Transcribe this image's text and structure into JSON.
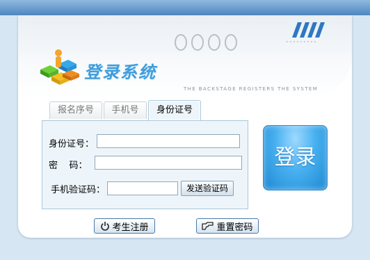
{
  "app": {
    "title": "登录系统",
    "subtitle": "THE BACKSTAGE REGISTERS THE SYSTEM"
  },
  "tabs": [
    {
      "label": "报名序号",
      "active": false
    },
    {
      "label": "手机号",
      "active": false
    },
    {
      "label": "身份证号",
      "active": true
    }
  ],
  "form": {
    "id_label": "身份证号：",
    "id_value": "",
    "password_label": "密    码：",
    "password_value": "",
    "sms_label": "手机验证码：",
    "sms_value": "",
    "send_code_label": "发送验证码"
  },
  "login_label": "登录",
  "footer": {
    "register_label": "考生注册",
    "register_icon": "power-icon",
    "reset_label": "重置密码",
    "reset_icon": "key-hand-icon"
  },
  "colors": {
    "accent": "#3f9ddc",
    "login_button": "#48b0f0",
    "top_bar": "#4e86bf",
    "background": "#d6e6f2"
  }
}
